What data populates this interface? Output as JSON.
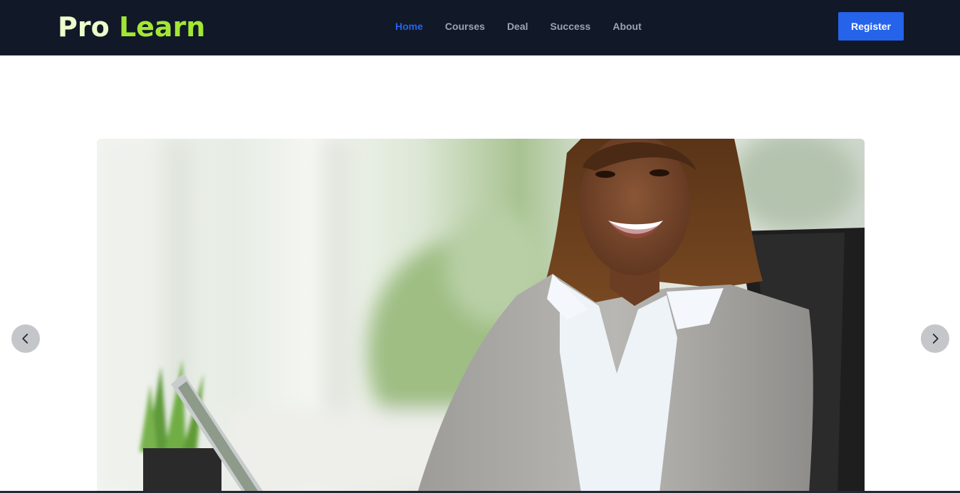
{
  "brand": {
    "word1": "Pro",
    "word2": "Learn"
  },
  "nav": {
    "items": [
      {
        "label": "Home",
        "active": true
      },
      {
        "label": "Courses",
        "active": false
      },
      {
        "label": "Deal",
        "active": false
      },
      {
        "label": "Success",
        "active": false
      },
      {
        "label": "About",
        "active": false
      }
    ]
  },
  "header": {
    "register_label": "Register"
  },
  "carousel": {
    "prev_icon": "chevron-left-icon",
    "next_icon": "chevron-right-icon",
    "slide_image": "smiling-businesswoman-at-desk-photo"
  },
  "colors": {
    "navbar_bg": "#111827",
    "brand_light": "#ecfccb",
    "brand_accent": "#a3e635",
    "link_active": "#2563eb",
    "link_default": "#9ca3af",
    "register_bg": "#2563eb"
  }
}
